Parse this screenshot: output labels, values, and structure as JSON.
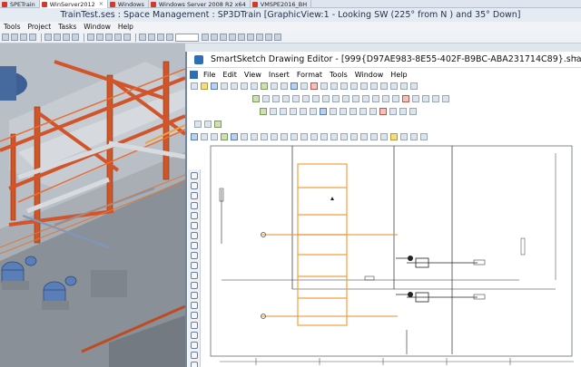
{
  "vm_tabs": [
    {
      "label": "SPETrain",
      "active": false
    },
    {
      "label": "WinServer2012",
      "active": true
    },
    {
      "label": "Windows",
      "active": false
    },
    {
      "label": "Windows Server 2008 R2 x64",
      "active": false
    },
    {
      "label": "VMSPE2016_BH",
      "active": false
    }
  ],
  "s3d": {
    "title": "TrainTest.ses : Space Management : SP3DTrain   [GraphicView:1 - Looking SW (225° from N ) and 35° Down]",
    "menu": [
      "Tools",
      "Project",
      "Tasks",
      "Window",
      "Help"
    ]
  },
  "sse": {
    "title": "SmartSketch Drawing Editor - [999{D97AE983-8E55-402F-B9BC-ABA231714C89}.sha - 999]",
    "minimize": "–",
    "menu": [
      "File",
      "Edit",
      "View",
      "Insert",
      "Format",
      "Tools",
      "Window",
      "Help"
    ]
  },
  "colors": {
    "steel": "#d2542a",
    "pipe": "#5b7fbf",
    "slab": "#9da3a9",
    "highlight": "#f0a040"
  }
}
